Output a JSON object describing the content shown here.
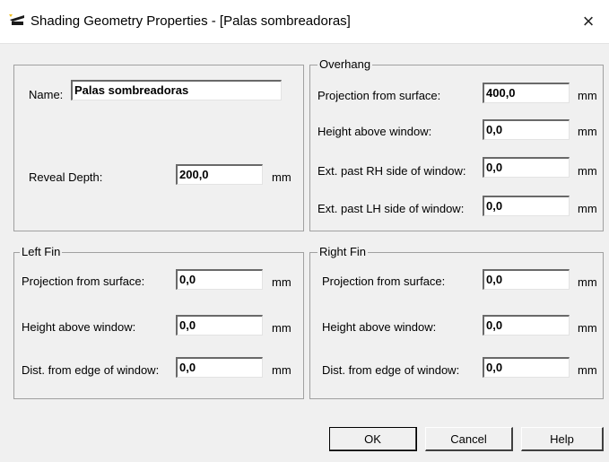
{
  "window": {
    "title": "Shading Geometry Properties - [Palas sombreadoras]",
    "close_glyph": "×"
  },
  "general": {
    "name_label": "Name:",
    "name_value": "Palas sombreadoras",
    "reveal_label": "Reveal Depth:",
    "reveal_value": "200,0",
    "reveal_unit": "mm"
  },
  "overhang": {
    "legend": "Overhang",
    "rows": [
      {
        "label": "Projection from surface:",
        "value": "400,0",
        "unit": "mm"
      },
      {
        "label": "Height above window:",
        "value": "0,0",
        "unit": "mm"
      },
      {
        "label": "Ext. past RH side of window:",
        "value": "0,0",
        "unit": "mm"
      },
      {
        "label": "Ext. past LH side of window:",
        "value": "0,0",
        "unit": "mm"
      }
    ]
  },
  "left_fin": {
    "legend": "Left Fin",
    "rows": [
      {
        "label": "Projection from surface:",
        "value": "0,0",
        "unit": "mm"
      },
      {
        "label": "Height above window:",
        "value": "0,0",
        "unit": "mm"
      },
      {
        "label": "Dist. from edge of window:",
        "value": "0,0",
        "unit": "mm"
      }
    ]
  },
  "right_fin": {
    "legend": "Right Fin",
    "rows": [
      {
        "label": "Projection from surface:",
        "value": "0,0",
        "unit": "mm"
      },
      {
        "label": "Height above window:",
        "value": "0,0",
        "unit": "mm"
      },
      {
        "label": "Dist. from edge of window:",
        "value": "0,0",
        "unit": "mm"
      }
    ]
  },
  "buttons": {
    "ok": "OK",
    "cancel": "Cancel",
    "help": "Help"
  }
}
